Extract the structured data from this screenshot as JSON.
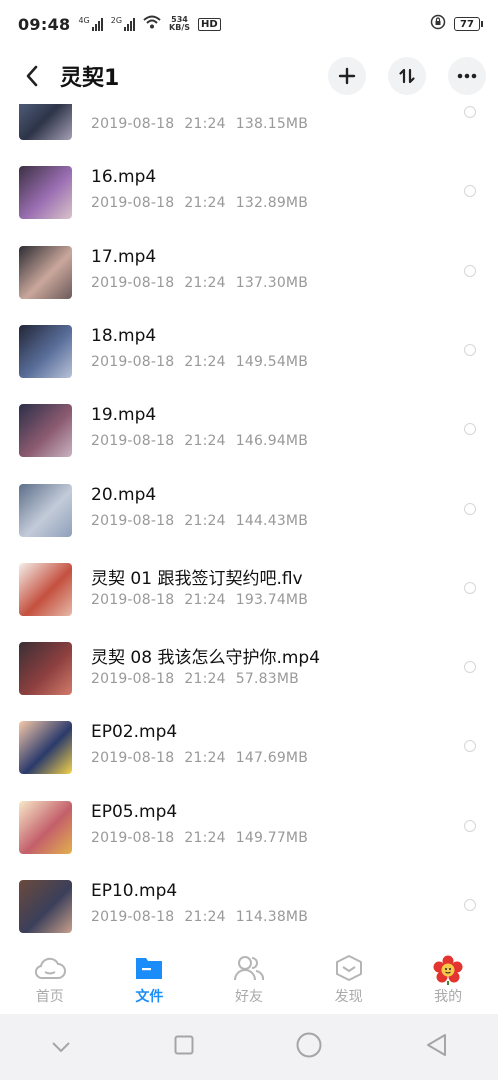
{
  "status_bar": {
    "time": "09:48",
    "sim1": "4G",
    "sim2": "2G",
    "speed_value": "534",
    "speed_unit": "KB/S",
    "hd": "HD",
    "battery": "77"
  },
  "header": {
    "title": "灵契1",
    "icons": [
      "back-icon",
      "add-icon",
      "sort-icon",
      "more-icon"
    ]
  },
  "files": [
    {
      "name": "",
      "date": "2019-08-18",
      "time": "21:24",
      "size": "138.15MB",
      "thumb_colors": [
        "#5b6b8a",
        "#2d3448",
        "#a7a0b6"
      ]
    },
    {
      "name": "16.mp4",
      "date": "2019-08-18",
      "time": "21:24",
      "size": "132.89MB",
      "thumb_colors": [
        "#3c3043",
        "#9b6fb3",
        "#d9c3c8"
      ]
    },
    {
      "name": "17.mp4",
      "date": "2019-08-18",
      "time": "21:24",
      "size": "137.30MB",
      "thumb_colors": [
        "#2c2c33",
        "#caa79b",
        "#6b5a5a"
      ]
    },
    {
      "name": "18.mp4",
      "date": "2019-08-18",
      "time": "21:24",
      "size": "149.54MB",
      "thumb_colors": [
        "#232638",
        "#5a6f9b",
        "#b9c3d9"
      ]
    },
    {
      "name": "19.mp4",
      "date": "2019-08-18",
      "time": "21:24",
      "size": "146.94MB",
      "thumb_colors": [
        "#2b2f48",
        "#8b5a6f",
        "#c9b3c3"
      ]
    },
    {
      "name": "20.mp4",
      "date": "2019-08-18",
      "time": "21:24",
      "size": "144.43MB",
      "thumb_colors": [
        "#5d6f8a",
        "#c3cbd9",
        "#8fa0ba"
      ]
    },
    {
      "name": "灵契 01 跟我签订契约吧.flv",
      "date": "2019-08-18",
      "time": "21:24",
      "size": "193.74MB",
      "thumb_colors": [
        "#f4efe9",
        "#c4503f",
        "#e6b9a8"
      ]
    },
    {
      "name": "灵契 08 我该怎么守护你.mp4",
      "date": "2019-08-18",
      "time": "21:24",
      "size": "57.83MB",
      "thumb_colors": [
        "#3a2f35",
        "#8c3f3f",
        "#d27b6b"
      ]
    },
    {
      "name": "EP02.mp4",
      "date": "2019-08-18",
      "time": "21:24",
      "size": "147.69MB",
      "thumb_colors": [
        "#f7c9a9",
        "#2a3a6b",
        "#f5d24a"
      ]
    },
    {
      "name": "EP05.mp4",
      "date": "2019-08-18",
      "time": "21:24",
      "size": "149.77MB",
      "thumb_colors": [
        "#f7e9c9",
        "#c35f6a",
        "#e3b04f"
      ]
    },
    {
      "name": "EP10.mp4",
      "date": "2019-08-18",
      "time": "21:24",
      "size": "114.38MB",
      "thumb_colors": [
        "#6b4a3c",
        "#3b3f5a",
        "#c9a08b"
      ]
    }
  ],
  "tabs": [
    {
      "label": "首页",
      "icon": "cloud-home-icon",
      "active": false
    },
    {
      "label": "文件",
      "icon": "folder-icon",
      "active": true
    },
    {
      "label": "好友",
      "icon": "friends-icon",
      "active": false
    },
    {
      "label": "发现",
      "icon": "discover-icon",
      "active": false
    },
    {
      "label": "我的",
      "icon": "flower-avatar-icon",
      "active": false
    }
  ],
  "nav": {
    "icons": [
      "nav-down-icon",
      "nav-square-icon",
      "nav-circle-icon",
      "nav-back-icon"
    ]
  },
  "colors": {
    "accent": "#1a8dfa",
    "meta_text": "#999999",
    "tab_inactive": "#aaaaaa"
  }
}
